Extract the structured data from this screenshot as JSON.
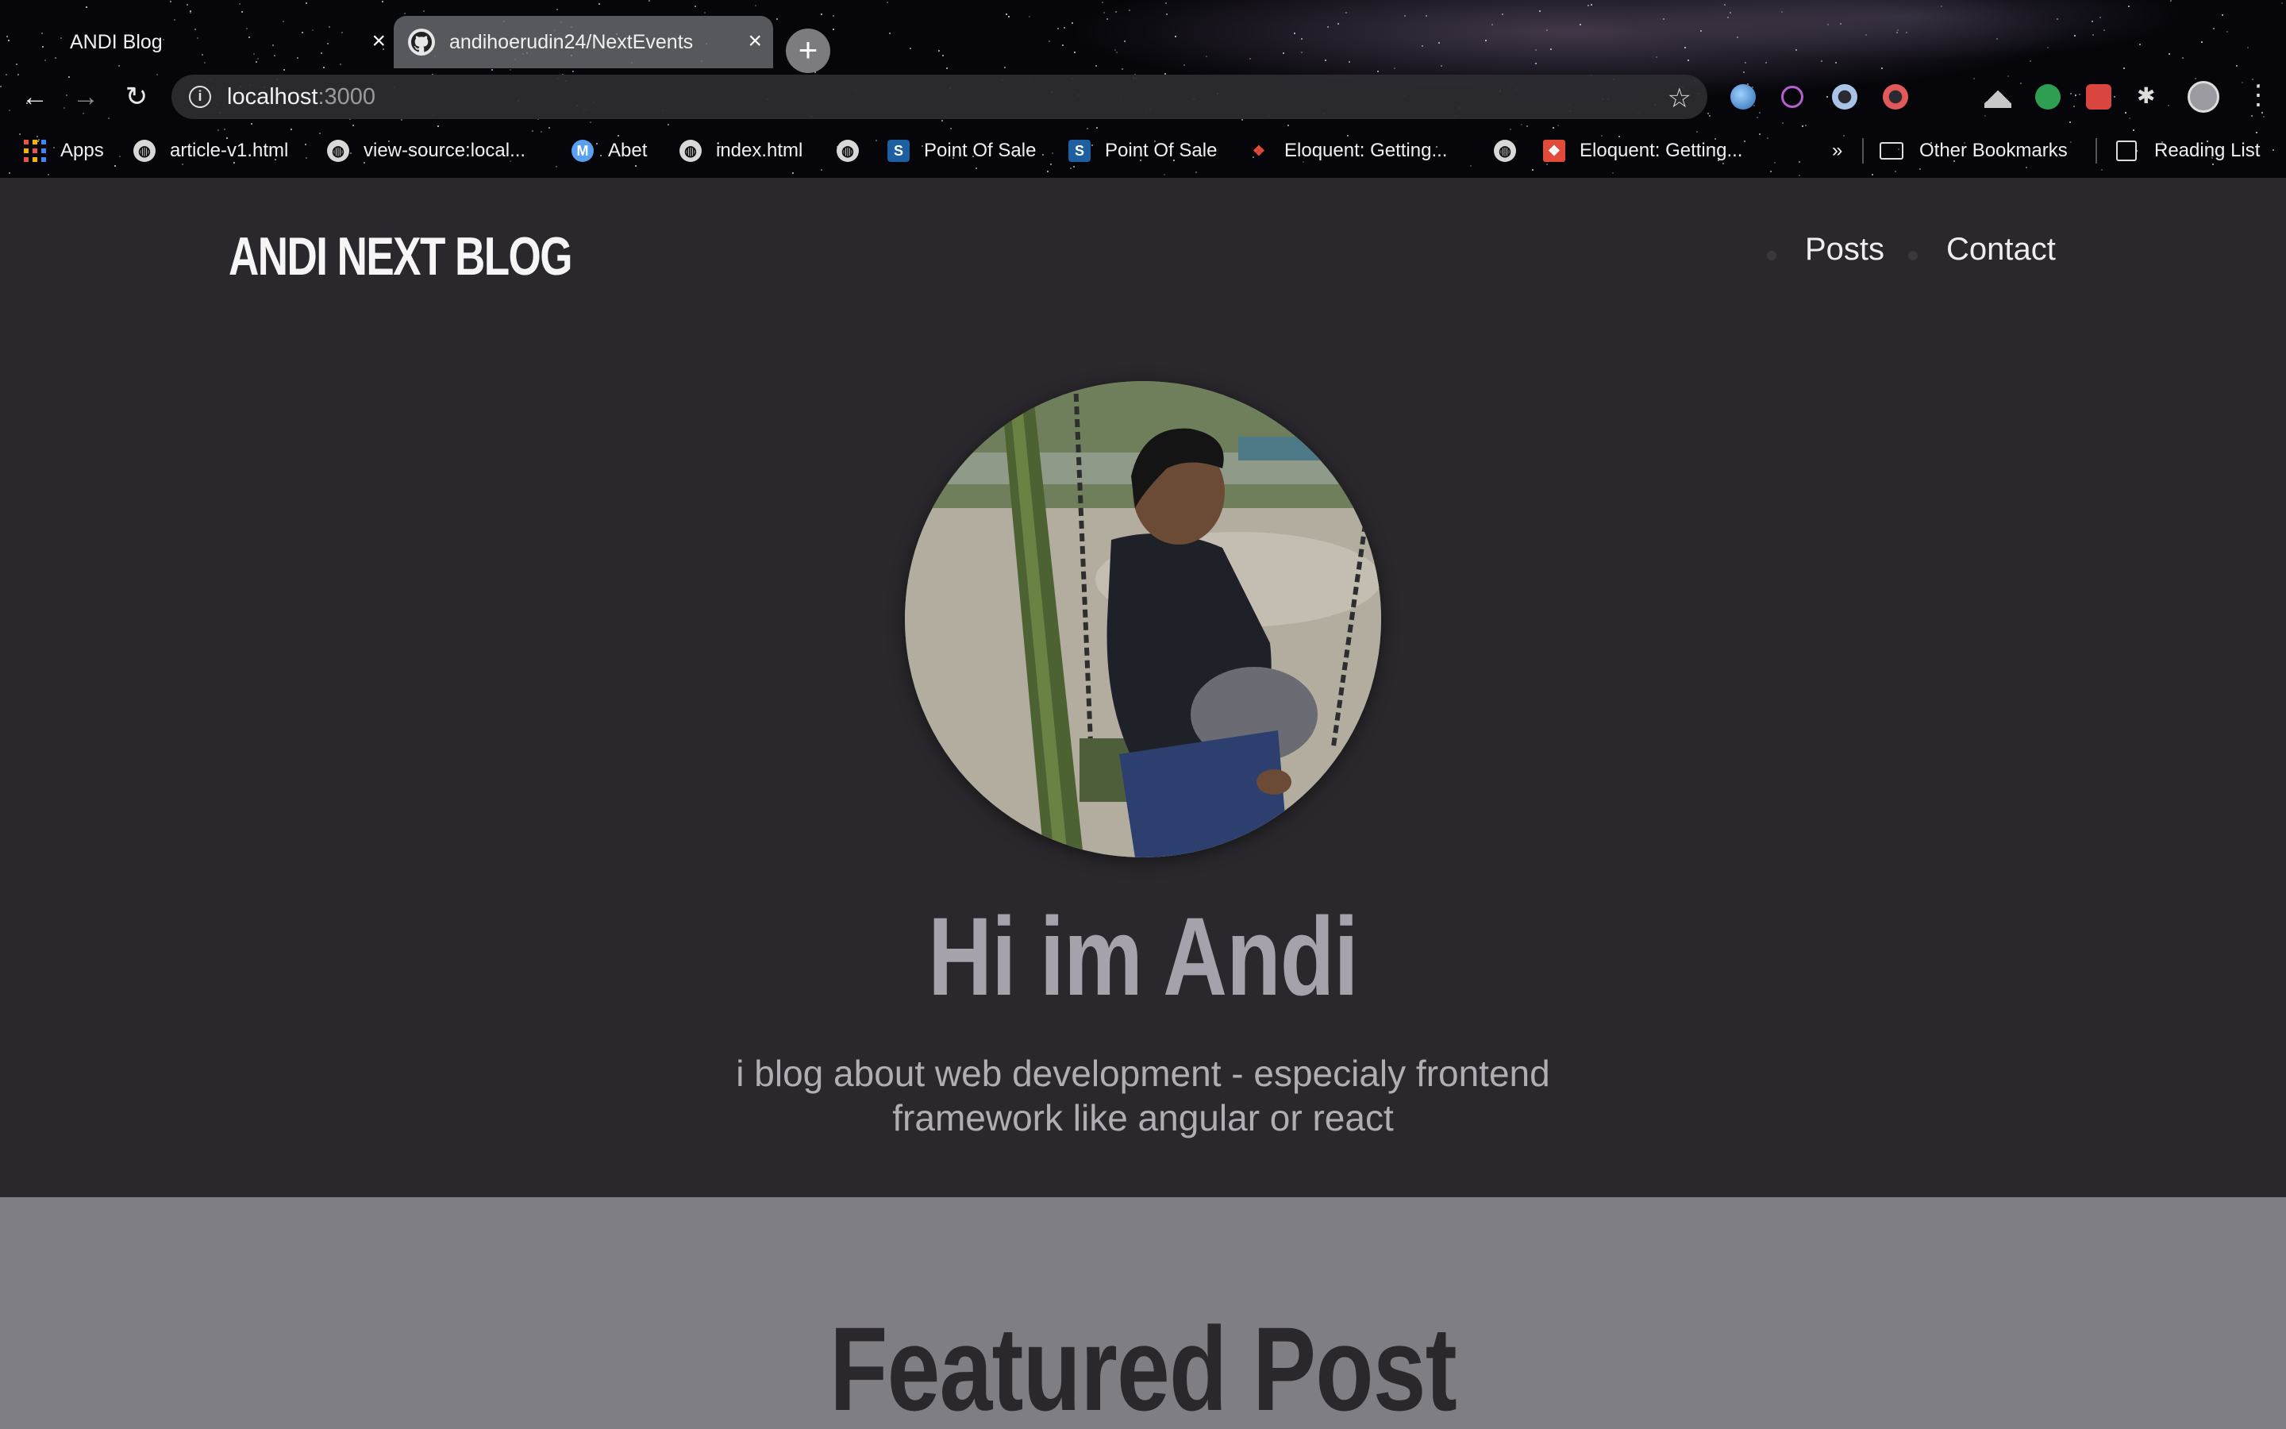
{
  "browser": {
    "tabs": [
      {
        "title": "ANDI Blog",
        "active": false
      },
      {
        "title": "andihoerudin24/NextEvents",
        "active": true
      }
    ],
    "tab_close_glyph": "×",
    "new_tab_glyph": "+",
    "back_glyph": "←",
    "forward_glyph": "→",
    "reload_glyph": "↻",
    "info_glyph": "i",
    "url_host": "localhost",
    "url_port": ":3000",
    "star_glyph": "☆",
    "menu_glyph": "⋮",
    "bookmarks": [
      {
        "label": "Apps",
        "icon": "apps-grid-icon"
      },
      {
        "label": "article-v1.html",
        "icon": "globe-icon"
      },
      {
        "label": "view-source:local...",
        "icon": "globe-icon"
      },
      {
        "label": "Abet",
        "icon": "avatar-icon"
      },
      {
        "label": "index.html",
        "icon": "globe-icon"
      },
      {
        "label": "",
        "icon": "globe-icon"
      },
      {
        "label": "Point Of Sale",
        "icon": "shopify-icon"
      },
      {
        "label": "Point Of Sale",
        "icon": "shopify-icon"
      },
      {
        "label": "Eloquent: Getting...",
        "icon": "laravel-icon"
      },
      {
        "label": "",
        "icon": "globe-icon"
      },
      {
        "label": "Eloquent: Getting...",
        "icon": "laravel-icon"
      }
    ],
    "bookmarks_overflow": "»",
    "other_bookmarks": "Other Bookmarks",
    "reading_list": "Reading List",
    "colors": {
      "chrome_bg": "#05050a",
      "active_tab": "#6e6e76",
      "omnibox": "#2d2c32"
    }
  },
  "site": {
    "logo": "ANDI NEXT BLOG",
    "nav": [
      {
        "label": "Posts"
      },
      {
        "label": "Contact"
      }
    ],
    "hero": {
      "title": "Hi im Andi",
      "subtitle_line1": "i blog about web development - especialy frontend",
      "subtitle_line2": "framework like angular or react"
    },
    "featured": {
      "title": "Featured Post"
    },
    "colors": {
      "hero_bg": "#2a282c",
      "featured_bg": "#807e85",
      "title": "#a6a2ab"
    }
  }
}
